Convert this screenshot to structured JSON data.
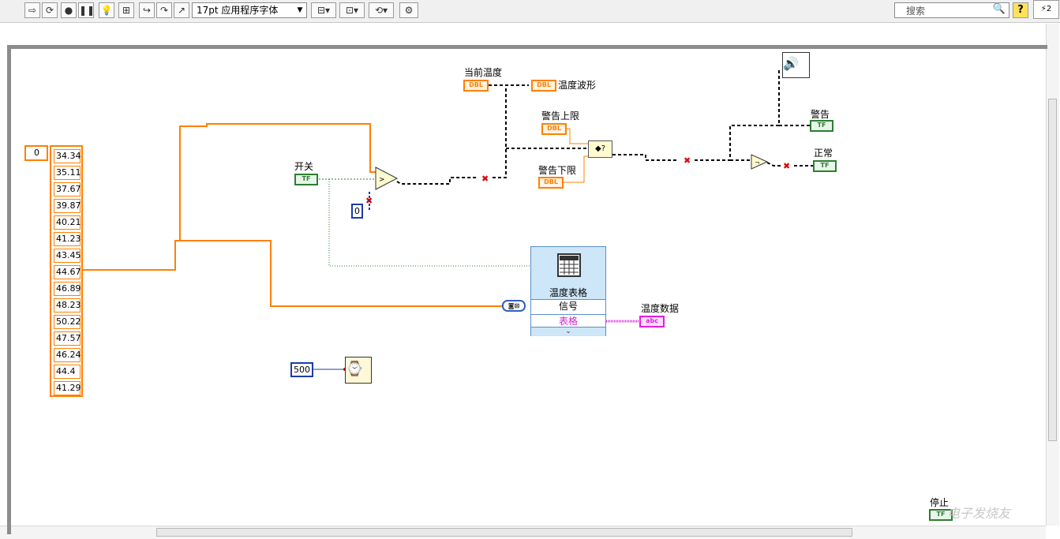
{
  "toolbar": {
    "font_select": "17pt 应用程序字体",
    "search_placeholder": "搜索"
  },
  "diagram": {
    "array_index": "0",
    "array_values": [
      "34.34",
      "35.11",
      "37.67",
      "39.87",
      "40.21",
      "41.23",
      "43.45",
      "44.67",
      "46.89",
      "48.23",
      "50.22",
      "47.57",
      "46.24",
      "44.4",
      "41.29"
    ],
    "switch_label": "开关",
    "switch_term": "TF",
    "zero_const": "0",
    "current_temp_label": "当前温度",
    "dbl_text": "DBL",
    "temp_waveform_label": "温度波形",
    "upper_limit_label": "警告上限",
    "lower_limit_label": "警告下限",
    "warning_label": "警告",
    "normal_label": "正常",
    "table_vi_title": "温度表格",
    "signal_row": "信号",
    "table_row": "表格",
    "temp_data_label": "温度数据",
    "abc_text": "abc",
    "wait_const": "500",
    "stop_label": "停止",
    "watermark": "电子发烧友"
  },
  "colors": {
    "orange_wire": "#ff8000",
    "bool_wire": "#2e7d32",
    "string_wire": "#e020e0",
    "int_wire": "#1a3da8"
  }
}
